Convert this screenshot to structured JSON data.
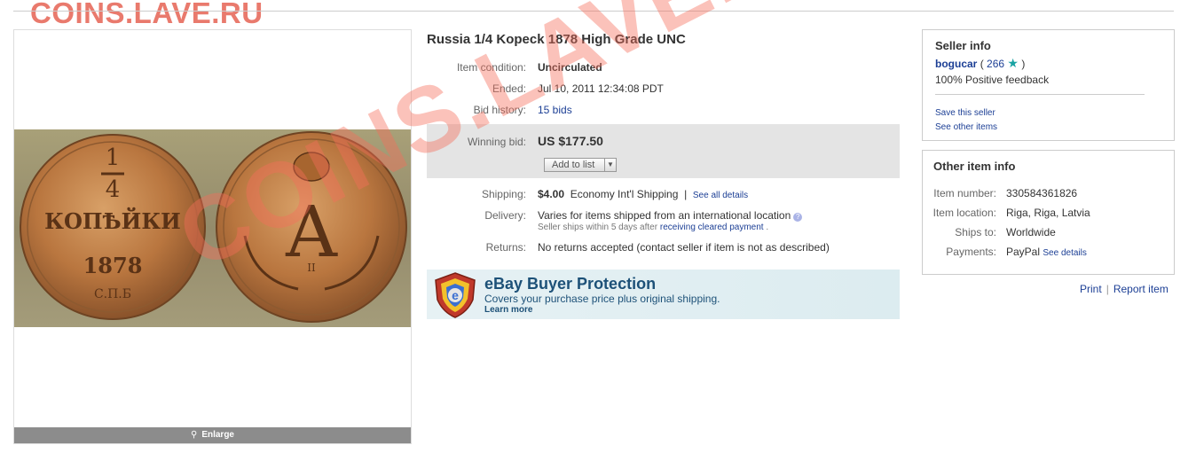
{
  "site_banner": "COINS.LAVE.RU",
  "watermark": "COINS.LAVE.RU",
  "image": {
    "enlarge_label": "Enlarge",
    "coin_left_lines": [
      "1",
      "4",
      "КОПѢЙКИ",
      "1878",
      "С.П.Б"
    ],
    "coin_right_monogram": "А",
    "coin_right_numeral": "II"
  },
  "item": {
    "title": "Russia 1/4 Kopeck 1878 High Grade UNC",
    "condition_label": "Item condition:",
    "condition_value": "Uncirculated",
    "ended_label": "Ended:",
    "ended_value": "Jul 10, 2011 12:34:08 PDT",
    "bids_label": "Bid history:",
    "bids_value": "15 bids",
    "winning_label": "Winning bid:",
    "winning_value": "US $177.50",
    "add_to_list": "Add to list",
    "shipping_label": "Shipping:",
    "shipping_cost": "$4.00",
    "shipping_service": "Economy Int'l Shipping",
    "shipping_sep": "|",
    "shipping_details": "See all details",
    "delivery_label": "Delivery:",
    "delivery_value": "Varies for items shipped from an international location",
    "delivery_note_prefix": "Seller ships within 5 days after",
    "delivery_note_link": "receiving cleared payment",
    "delivery_note_suffix": ".",
    "returns_label": "Returns:",
    "returns_value": "No returns accepted (contact seller if item is not as described)"
  },
  "protection": {
    "title": "eBay Buyer Protection",
    "subtitle": "Covers your purchase price plus original shipping.",
    "learn_more": "Learn more"
  },
  "seller": {
    "box_title": "Seller info",
    "name": "bogucar",
    "open_paren": "(",
    "score": "266",
    "close_paren": ")",
    "feedback": "100% Positive feedback",
    "save_seller": "Save this seller",
    "other_items": "See other items"
  },
  "other_info": {
    "box_title": "Other item info",
    "item_number_label": "Item number:",
    "item_number": "330584361826",
    "location_label": "Item location:",
    "location": "Riga, Riga, Latvia",
    "ships_label": "Ships to:",
    "ships": "Worldwide",
    "payments_label": "Payments:",
    "payments": "PayPal",
    "payments_details": "See details"
  },
  "footer": {
    "print": "Print",
    "sep": "|",
    "report": "Report item"
  },
  "colors": {
    "link": "#1c3f95",
    "watermark": "#f56e5a",
    "star": "#1aa3a3"
  },
  "icons": [
    "magnifier-icon",
    "dropdown-arrow-icon",
    "help-icon",
    "star-icon",
    "shield-icon"
  ]
}
